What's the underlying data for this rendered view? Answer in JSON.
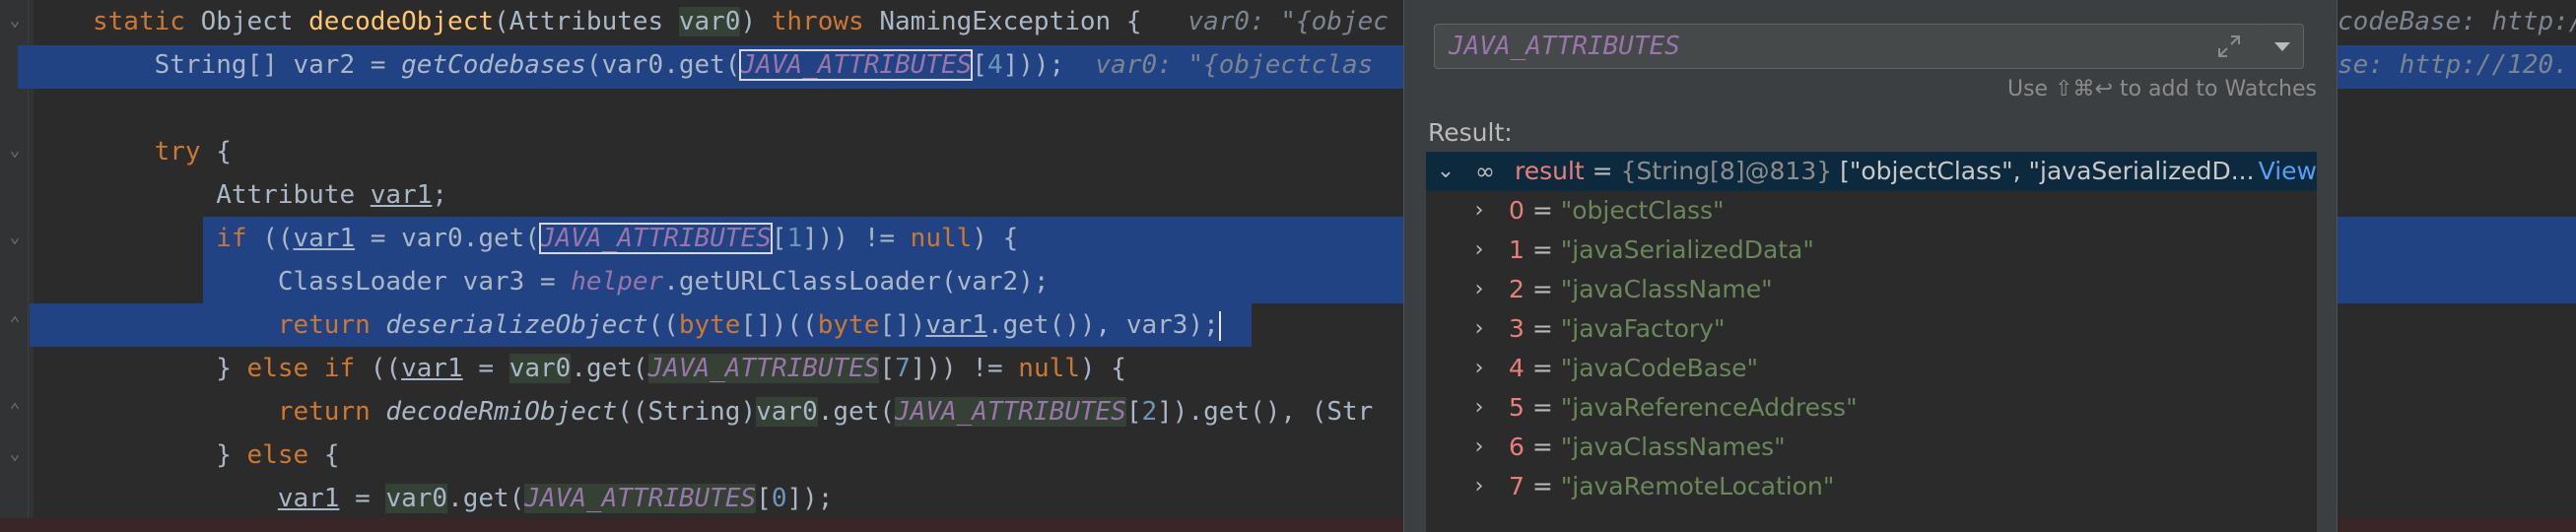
{
  "editor": {
    "lines": [
      {
        "parts": [
          [
            "static ",
            "kw"
          ],
          [
            "Object ",
            ""
          ],
          [
            "decodeObject",
            "fn"
          ],
          [
            "(Attributes ",
            ""
          ],
          [
            "var0",
            "greenbg"
          ],
          [
            ") ",
            ""
          ],
          [
            "throws ",
            "kw"
          ],
          [
            "NamingException {",
            ""
          ],
          [
            "   var0: \"{objec",
            "inline-hint"
          ]
        ]
      },
      {
        "parts": [
          [
            "    String[] var2 = ",
            ""
          ],
          [
            "getCodebases",
            "ital-fn"
          ],
          [
            "(var0.get(",
            ""
          ],
          [
            "JAVA_ATTRIBUTES",
            "const box"
          ],
          [
            "[",
            ""
          ],
          [
            "4",
            "num"
          ],
          [
            "]));",
            ""
          ],
          [
            "  var0: \"{objectclas",
            "inline-hint"
          ]
        ]
      },
      {
        "parts": []
      },
      {
        "parts": [
          [
            "    try ",
            "kw"
          ],
          [
            "{",
            ""
          ]
        ]
      },
      {
        "parts": [
          [
            "        Attribute ",
            ""
          ],
          [
            "var1",
            "ul"
          ],
          [
            ";",
            ""
          ]
        ]
      },
      {
        "parts": [
          [
            "        if ",
            "kw"
          ],
          [
            "((",
            ""
          ],
          [
            "var1",
            "ul"
          ],
          [
            " = var0.get(",
            ""
          ],
          [
            "JAVA_ATTRIBUTES",
            "const box"
          ],
          [
            "[",
            ""
          ],
          [
            "1",
            "num"
          ],
          [
            "])) != ",
            ""
          ],
          [
            "null",
            "kw"
          ],
          [
            ") {",
            ""
          ]
        ]
      },
      {
        "parts": [
          [
            "            ClassLoader var3 = ",
            ""
          ],
          [
            "helper",
            "field"
          ],
          [
            ".getURLClassLoader(var2);",
            ""
          ]
        ]
      },
      {
        "parts": [
          [
            "            return ",
            "kw"
          ],
          [
            "deserializeObject",
            "ital-fn"
          ],
          [
            "((",
            ""
          ],
          [
            "byte",
            "kw"
          ],
          [
            "[])((",
            ""
          ],
          [
            "byte",
            "kw"
          ],
          [
            "[])",
            ""
          ],
          [
            "var1",
            "ul"
          ],
          [
            ".get()), var3);",
            ""
          ]
        ]
      },
      {
        "parts": [
          [
            "        } ",
            ""
          ],
          [
            "else if ",
            "kw"
          ],
          [
            "((",
            ""
          ],
          [
            "var1",
            "ul"
          ],
          [
            " = ",
            ""
          ],
          [
            "var0",
            "greenbg"
          ],
          [
            ".get(",
            ""
          ],
          [
            "JAVA_ATTRIBUTES",
            "const greenbg"
          ],
          [
            "[",
            ""
          ],
          [
            "7",
            "num"
          ],
          [
            "])) != ",
            ""
          ],
          [
            "null",
            "kw"
          ],
          [
            ") {",
            ""
          ]
        ]
      },
      {
        "parts": [
          [
            "            return ",
            "kw"
          ],
          [
            "decodeRmiObject",
            "ital-fn"
          ],
          [
            "((String)",
            ""
          ],
          [
            "var0",
            "greenbg"
          ],
          [
            ".get(",
            ""
          ],
          [
            "JAVA_ATTRIBUTES",
            "const greenbg"
          ],
          [
            "[",
            ""
          ],
          [
            "2",
            "num"
          ],
          [
            "]).get(), (Str",
            ""
          ]
        ]
      },
      {
        "parts": [
          [
            "        } ",
            ""
          ],
          [
            "else ",
            "kw"
          ],
          [
            "{",
            ""
          ]
        ]
      },
      {
        "parts": [
          [
            "            ",
            ""
          ],
          [
            "var1",
            "ul"
          ],
          [
            " = ",
            ""
          ],
          [
            "var0",
            "greenbg"
          ],
          [
            ".get(",
            ""
          ],
          [
            "JAVA_ATTRIBUTES",
            "const greenbg"
          ],
          [
            "[",
            ""
          ],
          [
            "0",
            "num"
          ],
          [
            "]);",
            ""
          ]
        ]
      }
    ],
    "right_hints": {
      "line0": "codeBase: http:/",
      "line1": "se: http://120."
    }
  },
  "evaluate": {
    "expression": "JAVA_ATTRIBUTES",
    "watch_hint": "Use ⇧⌘↩ to add to Watches",
    "result_label": "Result:",
    "result": {
      "name": "result",
      "type": "{String[8]@813}",
      "preview": "[\"objectClass\", \"javaSerializedD...",
      "view_link": "View"
    },
    "items": [
      {
        "index": "0",
        "value": "\"objectClass\""
      },
      {
        "index": "1",
        "value": "\"javaSerializedData\""
      },
      {
        "index": "2",
        "value": "\"javaClassName\""
      },
      {
        "index": "3",
        "value": "\"javaFactory\""
      },
      {
        "index": "4",
        "value": "\"javaCodeBase\""
      },
      {
        "index": "5",
        "value": "\"javaReferenceAddress\""
      },
      {
        "index": "6",
        "value": "\"javaClassNames\""
      },
      {
        "index": "7",
        "value": "\"javaRemoteLocation\""
      }
    ]
  }
}
